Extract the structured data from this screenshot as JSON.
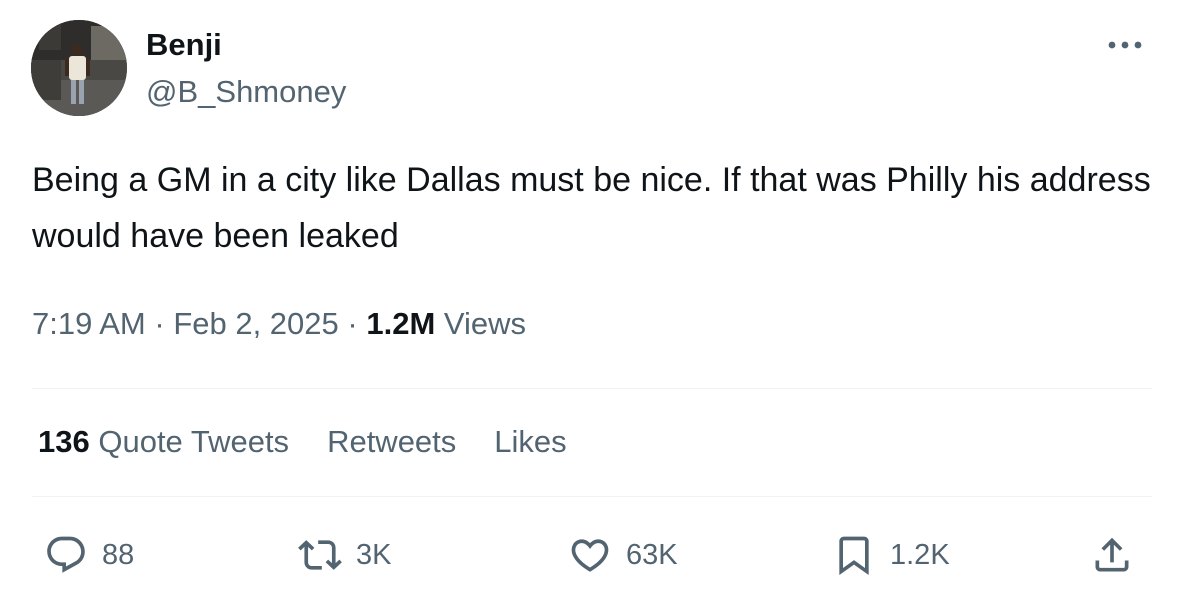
{
  "author": {
    "display_name": "Benji",
    "handle": "@B_Shmoney",
    "avatar_icon": "profile-photo"
  },
  "tweet": {
    "text": "Being a GM in a city like Dallas must be nice. If that was Philly his address would have been leaked"
  },
  "meta": {
    "time": "7:19 AM",
    "separator": " · ",
    "date": "Feb 2, 2025",
    "views_count": "1.2M",
    "views_label": " Views"
  },
  "stats": {
    "quote_count": "136",
    "quote_label": " Quote Tweets",
    "retweets_label": "Retweets",
    "likes_label": "Likes"
  },
  "actions": {
    "reply_count": "88",
    "retweet_count": "3K",
    "like_count": "63K",
    "bookmark_count": "1.2K"
  },
  "colors": {
    "text_primary": "#0f1419",
    "text_secondary": "#536471",
    "divider": "#eff3f4"
  },
  "icons": [
    "more-icon",
    "reply-icon",
    "retweet-icon",
    "heart-icon",
    "bookmark-icon",
    "share-icon"
  ]
}
